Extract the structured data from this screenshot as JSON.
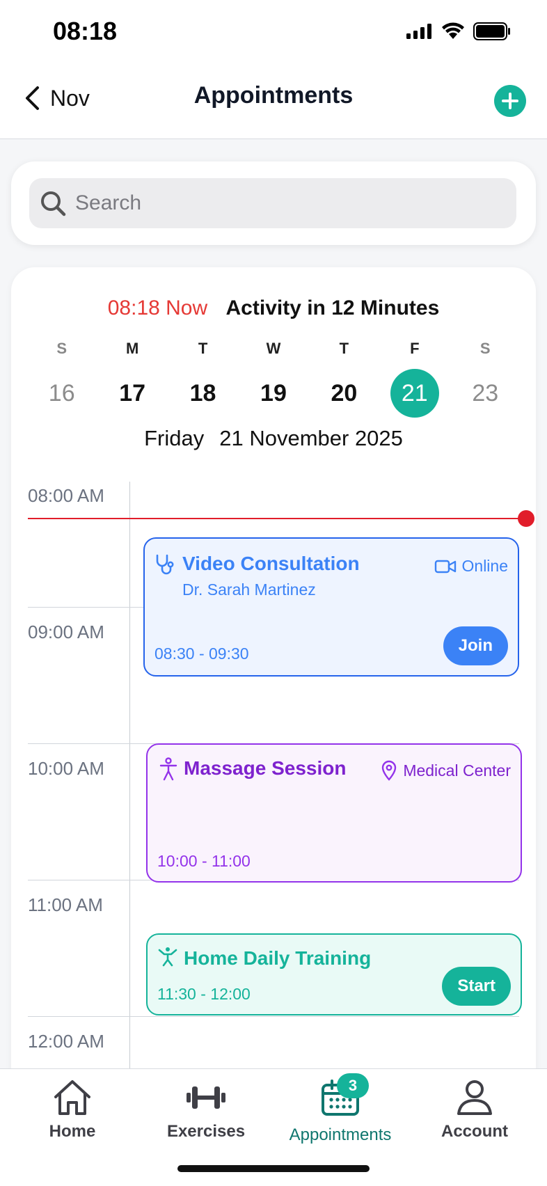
{
  "status_bar": {
    "time": "08:18"
  },
  "nav": {
    "back_label": "Nov",
    "title": "Appointments"
  },
  "search": {
    "placeholder": "Search",
    "value": ""
  },
  "now_banner": {
    "time_text": "08:18 Now",
    "activity_text": "Activity in 12 Minutes"
  },
  "week": [
    {
      "letter": "S",
      "number": "16"
    },
    {
      "letter": "M",
      "number": "17"
    },
    {
      "letter": "T",
      "number": "18"
    },
    {
      "letter": "W",
      "number": "19"
    },
    {
      "letter": "T",
      "number": "20"
    },
    {
      "letter": "F",
      "number": "21"
    },
    {
      "letter": "S",
      "number": "23"
    }
  ],
  "selected_date": {
    "weekday": "Friday",
    "full": "21 November 2025"
  },
  "hours": [
    "08:00 AM",
    "09:00 AM",
    "10:00 AM",
    "11:00 AM",
    "12:00 AM"
  ],
  "events": {
    "video": {
      "title": "Video Consultation",
      "subtitle": "Dr. Sarah Martinez",
      "mode": "Online",
      "time": "08:30 - 09:30",
      "action": "Join",
      "color": "#3b82f6"
    },
    "massage": {
      "title": "Massage Session",
      "location": "Medical Center",
      "time": "10:00 - 11:00",
      "color": "#7e22ce"
    },
    "training": {
      "title": "Home Daily Training",
      "time": "11:30 - 12:00",
      "action": "Start",
      "color": "#15b39a"
    }
  },
  "tabs": {
    "home": "Home",
    "exercises": "Exercises",
    "appointments": "Appointments",
    "appointments_badge": "3",
    "account": "Account"
  },
  "colors": {
    "accent": "#15b39a",
    "now": "#e11d2a",
    "video": "#3b82f6",
    "massage": "#7e22ce"
  }
}
